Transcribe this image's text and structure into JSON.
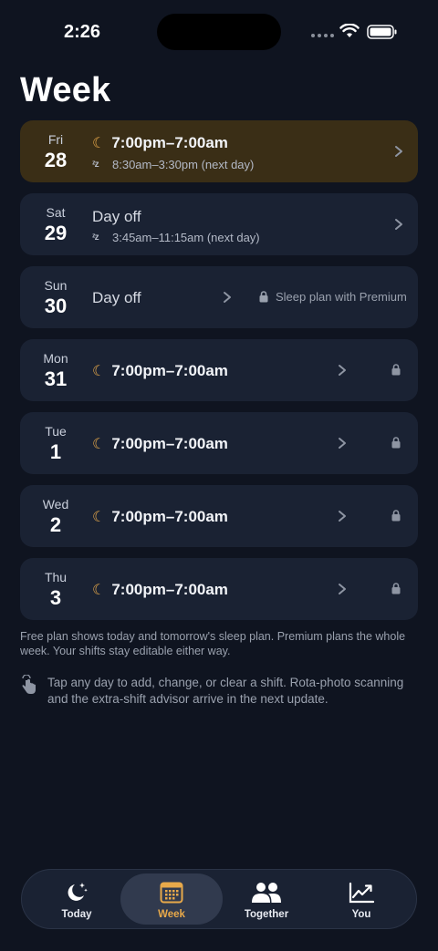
{
  "status_bar": {
    "time": "2:26"
  },
  "page_title": "Week",
  "days": [
    {
      "dow": "Fri",
      "date": "28",
      "today": true,
      "off_label": "",
      "shift": "7:00pm–7:00am",
      "sleep": "8:30am–3:30pm (next day)",
      "locked": false,
      "premium_note": ""
    },
    {
      "dow": "Sat",
      "date": "29",
      "today": false,
      "off_label": "Day off",
      "shift": "",
      "sleep": "3:45am–11:15am (next day)",
      "locked": false,
      "premium_note": ""
    },
    {
      "dow": "Sun",
      "date": "30",
      "today": false,
      "off_label": "Day off",
      "shift": "",
      "sleep": "",
      "locked": false,
      "premium_note": "Sleep plan with Premium"
    },
    {
      "dow": "Mon",
      "date": "31",
      "today": false,
      "off_label": "",
      "shift": "7:00pm–7:00am",
      "sleep": "",
      "locked": true,
      "premium_note": ""
    },
    {
      "dow": "Tue",
      "date": "1",
      "today": false,
      "off_label": "",
      "shift": "7:00pm–7:00am",
      "sleep": "",
      "locked": true,
      "premium_note": ""
    },
    {
      "dow": "Wed",
      "date": "2",
      "today": false,
      "off_label": "",
      "shift": "7:00pm–7:00am",
      "sleep": "",
      "locked": true,
      "premium_note": ""
    },
    {
      "dow": "Thu",
      "date": "3",
      "today": false,
      "off_label": "",
      "shift": "7:00pm–7:00am",
      "sleep": "",
      "locked": true,
      "premium_note": ""
    }
  ],
  "free_note": "Free plan shows today and tomorrow's sleep plan. Premium plans the whole week. Your shifts stay editable either way.",
  "tip": "Tap any day to add, change, or clear a shift. Rota-photo scanning and the extra-shift advisor arrive in the next update.",
  "tabs": [
    {
      "label": "Today",
      "icon": "moon-stars-icon",
      "active": false
    },
    {
      "label": "Week",
      "icon": "calendar-icon",
      "active": true
    },
    {
      "label": "Together",
      "icon": "people-icon",
      "active": false
    },
    {
      "label": "You",
      "icon": "trend-chart-icon",
      "active": false
    }
  ],
  "colors": {
    "background": "#0f1420",
    "card": "#1a2233",
    "today_card": "#3a2e16",
    "accent": "#e8a94a"
  }
}
